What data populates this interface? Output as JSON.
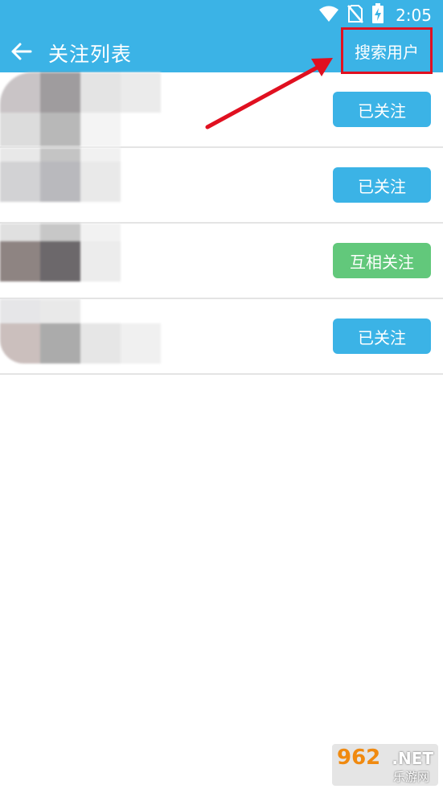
{
  "status_bar": {
    "time": "2:05",
    "icons": [
      "wifi-icon",
      "no-sim-icon",
      "battery-charging-icon"
    ]
  },
  "app_bar": {
    "title": "关注列表",
    "back_icon": "arrow-left-icon",
    "search_label": "搜索用户"
  },
  "rows": [
    {
      "button_label": "已关注",
      "button_type": "followed"
    },
    {
      "button_label": "已关注",
      "button_type": "followed"
    },
    {
      "button_label": "互相关注",
      "button_type": "mutual"
    },
    {
      "button_label": "已关注",
      "button_type": "followed"
    }
  ],
  "colors": {
    "header": "#3bb3e6",
    "followed_button": "#3bb3e6",
    "mutual_button": "#62c87b",
    "highlight": "#e01020"
  },
  "watermark": {
    "brand": "962",
    "suffix": ".NET",
    "text": "乐游网"
  }
}
